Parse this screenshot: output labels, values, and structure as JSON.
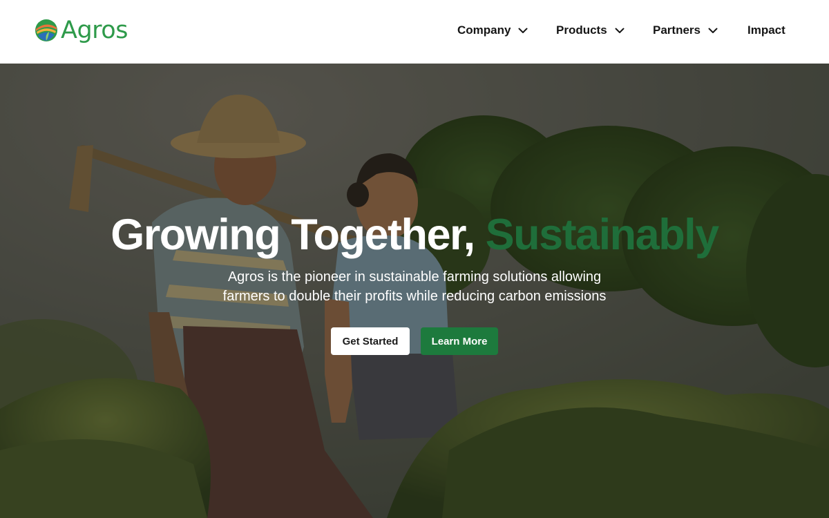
{
  "brand": {
    "name": "Agros",
    "color": "#2e9a4a"
  },
  "nav": {
    "items": [
      {
        "label": "Company",
        "has_dropdown": true
      },
      {
        "label": "Products",
        "has_dropdown": true
      },
      {
        "label": "Partners",
        "has_dropdown": true
      },
      {
        "label": "Impact",
        "has_dropdown": false
      }
    ]
  },
  "hero": {
    "title_main": "Growing Together, ",
    "title_accent": "Sustainably",
    "title_accent_color": "#1f6e3a",
    "subtitle_line1": "Agros is the pioneer in sustainable farming solutions allowing",
    "subtitle_line2": "farmers to double their profits while reducing carbon emissions",
    "primary_button": "Get Started",
    "secondary_button": "Learn More",
    "secondary_button_color": "#1d7a3d",
    "background_icon": "farmers-in-field-photo"
  }
}
